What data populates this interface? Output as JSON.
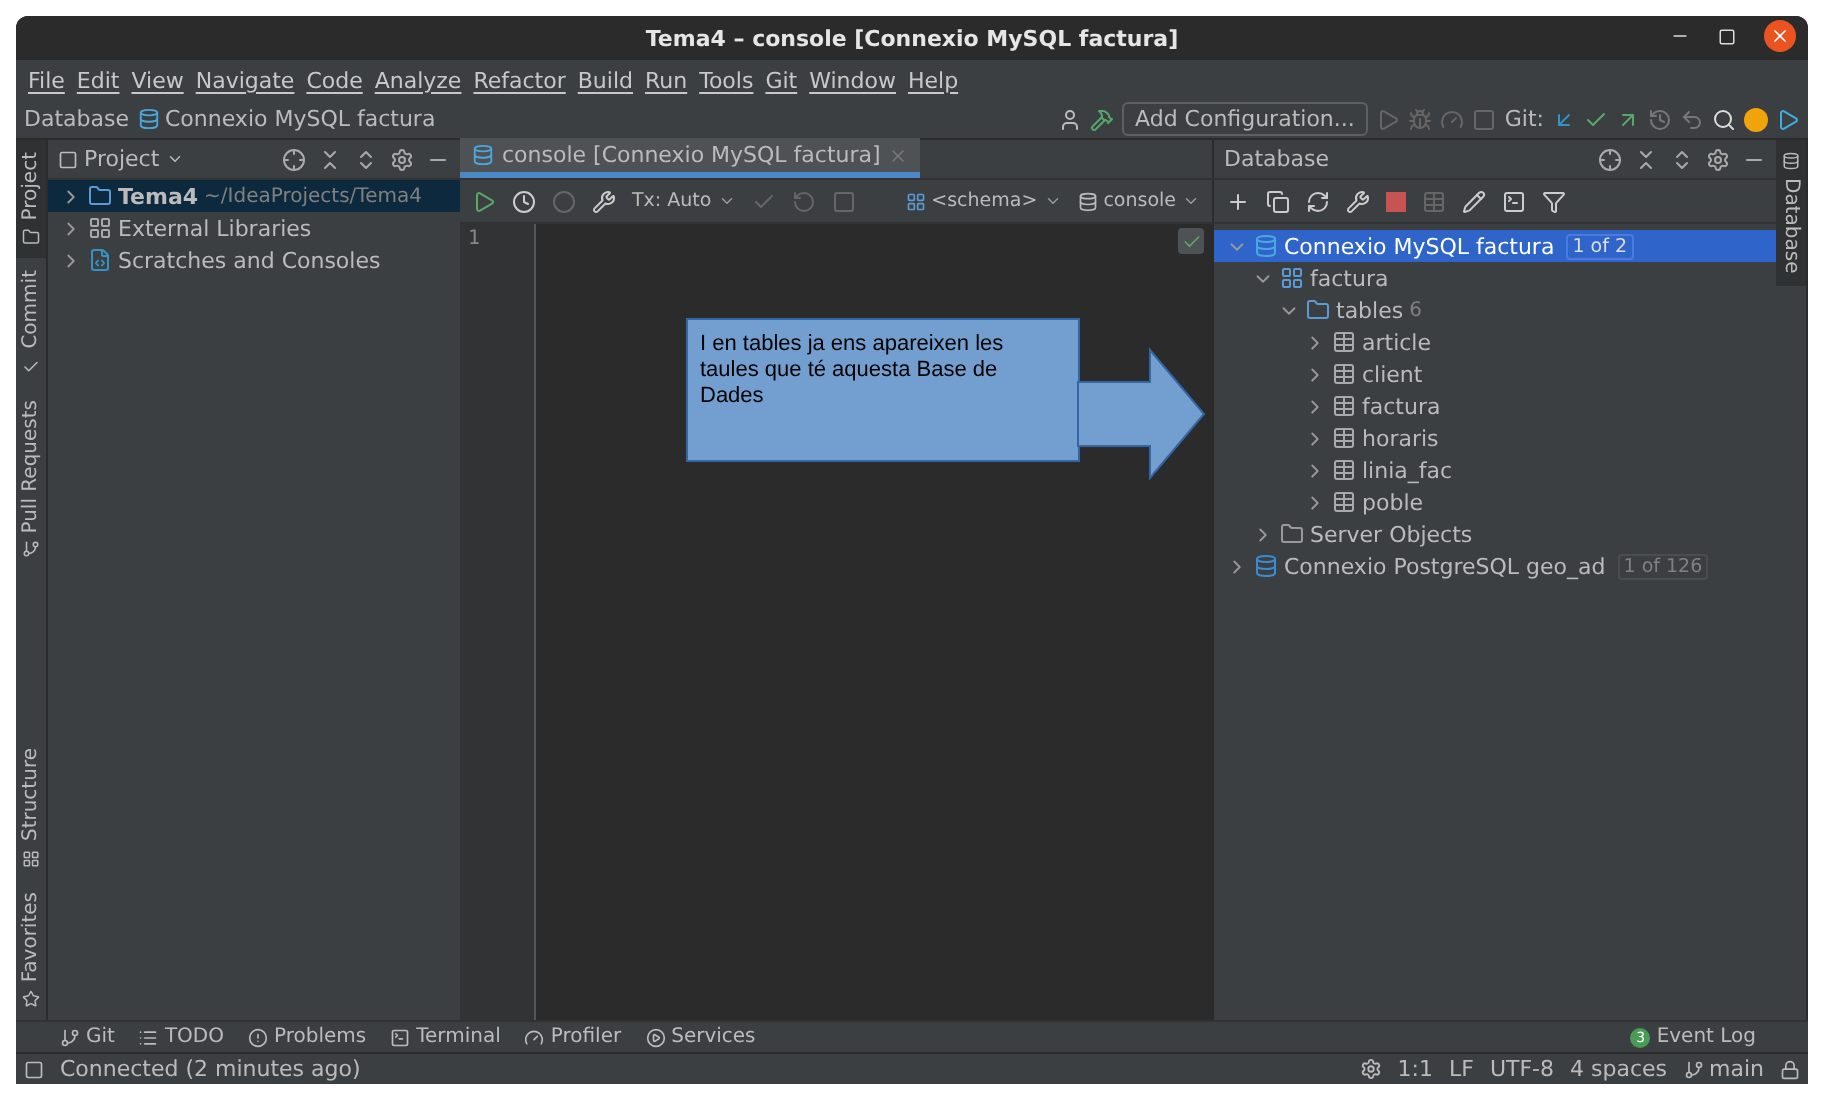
{
  "window": {
    "title": "Tema4 – console [Connexio MySQL factura]"
  },
  "menu": [
    "File",
    "Edit",
    "View",
    "Navigate",
    "Code",
    "Analyze",
    "Refactor",
    "Build",
    "Run",
    "Tools",
    "Git",
    "Window",
    "Help"
  ],
  "navbar": {
    "breadcrumb": [
      "Database",
      "Connexio MySQL factura"
    ],
    "run_config": "Add Configuration...",
    "git_label": "Git:"
  },
  "left_stripe": {
    "top": [
      {
        "label": "Project",
        "selected": true
      },
      {
        "label": "Commit",
        "selected": false
      },
      {
        "label": "Pull Requests",
        "selected": false
      }
    ],
    "bottom": [
      {
        "label": "Structure",
        "selected": false
      },
      {
        "label": "Favorites",
        "selected": false
      }
    ]
  },
  "project": {
    "title": "Project",
    "tree": [
      {
        "kind": "module",
        "name": "Tema4",
        "path": "~/IdeaProjects/Tema4",
        "selected": true,
        "expanded": false
      },
      {
        "kind": "libraries",
        "name": "External Libraries",
        "selected": false,
        "expanded": false
      },
      {
        "kind": "scratches",
        "name": "Scratches and Consoles",
        "selected": false,
        "expanded": false
      }
    ]
  },
  "editor": {
    "tab": {
      "label": "console [Connexio MySQL factura]",
      "selected": true
    },
    "tx": "Tx: Auto",
    "schema": "<schema>",
    "session": "console",
    "line_numbers": [
      "1"
    ]
  },
  "callout": {
    "text": "I en tables ja ens apareixen les taules que té aquesta Base de Dades"
  },
  "database": {
    "title": "Database",
    "tree": [
      {
        "kind": "connection",
        "name": "Connexio MySQL factura",
        "badge": "1 of 2",
        "selected": true,
        "expanded": true,
        "children": [
          {
            "kind": "schema",
            "name": "factura",
            "selected": false,
            "expanded": true,
            "children": [
              {
                "kind": "folder",
                "name": "tables",
                "count": "6",
                "selected": false,
                "expanded": true,
                "children": [
                  {
                    "kind": "table",
                    "name": "article",
                    "selected": false,
                    "expanded": false
                  },
                  {
                    "kind": "table",
                    "name": "client",
                    "selected": false,
                    "expanded": false
                  },
                  {
                    "kind": "table",
                    "name": "factura",
                    "selected": false,
                    "expanded": false
                  },
                  {
                    "kind": "table",
                    "name": "horaris",
                    "selected": false,
                    "expanded": false
                  },
                  {
                    "kind": "table",
                    "name": "linia_fac",
                    "selected": false,
                    "expanded": false
                  },
                  {
                    "kind": "table",
                    "name": "poble",
                    "selected": false,
                    "expanded": false
                  }
                ]
              }
            ]
          },
          {
            "kind": "server",
            "name": "Server Objects",
            "selected": false,
            "expanded": false
          }
        ]
      },
      {
        "kind": "pgconnection",
        "name": "Connexio PostgreSQL geo_ad",
        "badge": "1 of 126",
        "selected": false,
        "expanded": false
      }
    ]
  },
  "right_stripe": [
    {
      "label": "Database",
      "selected": true
    }
  ],
  "tool_tabs": [
    {
      "kind": "git",
      "label": "Git"
    },
    {
      "kind": "todo",
      "label": "TODO"
    },
    {
      "kind": "problems",
      "label": "Problems"
    },
    {
      "kind": "terminal",
      "label": "Terminal"
    },
    {
      "kind": "profiler",
      "label": "Profiler"
    },
    {
      "kind": "services",
      "label": "Services"
    }
  ],
  "event_log": {
    "label": "Event Log",
    "count": "3"
  },
  "status_bar": {
    "message": "Connected (2 minutes ago)",
    "items": [
      "1:1",
      "LF",
      "UTF-8",
      "4 spaces"
    ],
    "branch": "main"
  }
}
